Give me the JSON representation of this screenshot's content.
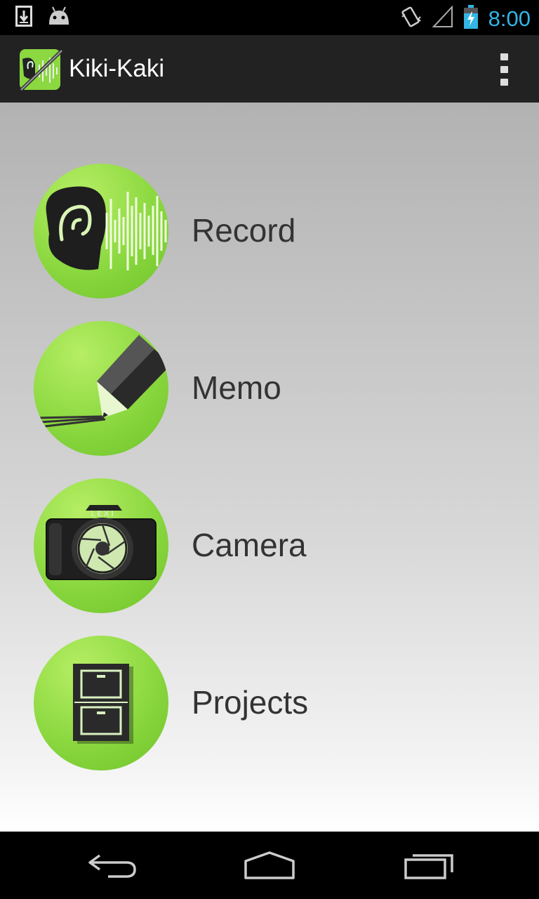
{
  "status_bar": {
    "time": "8:00",
    "icons": [
      "download-notification-icon",
      "android-debug-icon",
      "vibrate-icon",
      "signal-icon",
      "battery-charging-icon"
    ]
  },
  "action_bar": {
    "title": "Kiki-Kaki",
    "icon": "kiki-kaki-app-icon",
    "overflow_icon": "overflow-menu-icon"
  },
  "menu": {
    "items": [
      {
        "label": "Record",
        "icon": "ear-soundwave-icon"
      },
      {
        "label": "Memo",
        "icon": "pencil-icon"
      },
      {
        "label": "Camera",
        "icon": "camera-icon",
        "camera_brand": "LEXI"
      },
      {
        "label": "Projects",
        "icon": "file-cabinet-icon"
      }
    ]
  },
  "nav_bar": {
    "buttons": [
      "back-icon",
      "home-icon",
      "recent-apps-icon"
    ]
  },
  "colors": {
    "accent": "#33b5e5",
    "circle_green": "#8bd840",
    "action_bar": "#222222"
  }
}
